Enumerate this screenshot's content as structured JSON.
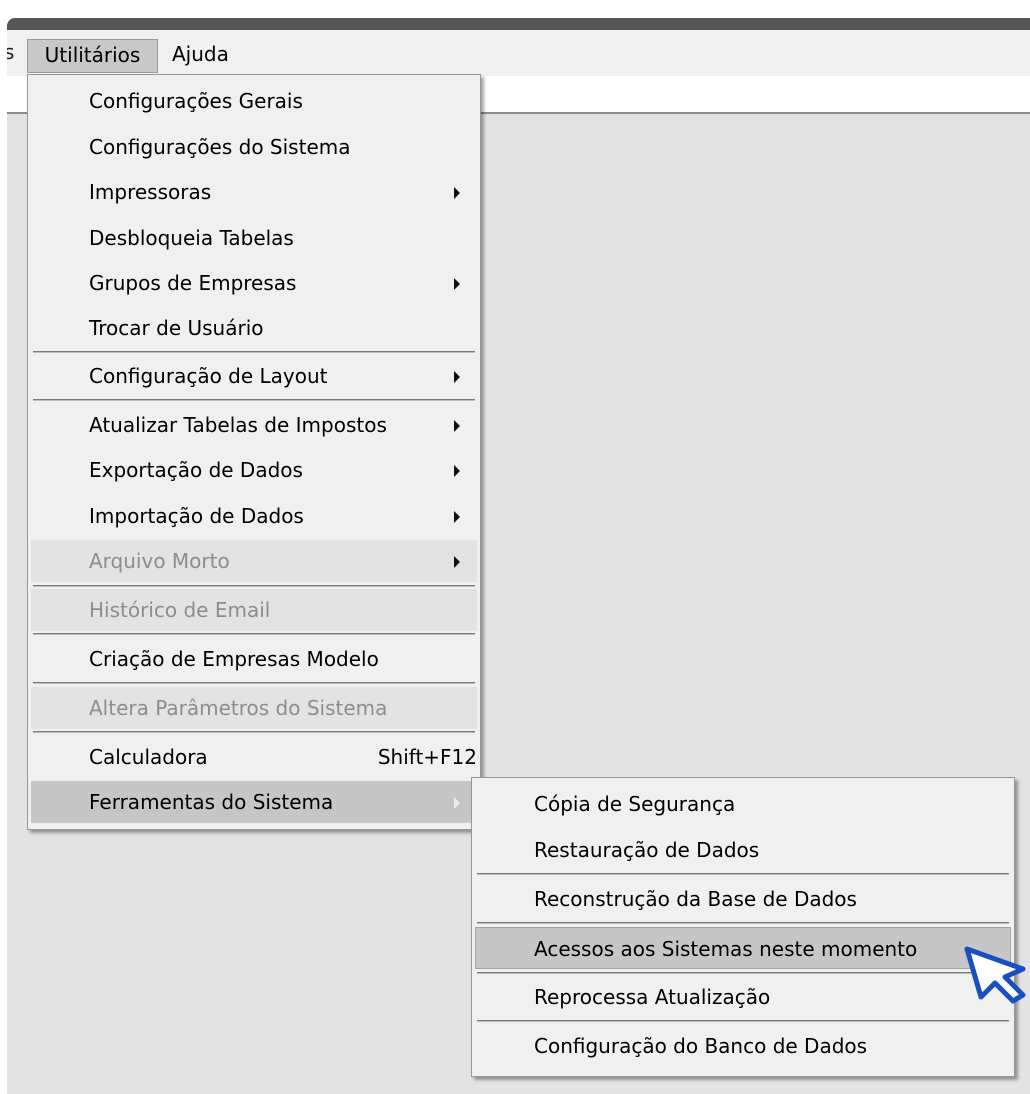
{
  "menubar": {
    "partial_item": "s",
    "items": [
      {
        "label": "Utilitários"
      },
      {
        "label": "Ajuda"
      }
    ]
  },
  "utilitarios_menu": {
    "items": [
      {
        "label": "Configurações Gerais"
      },
      {
        "label": "Configurações do Sistema"
      },
      {
        "label": "Impressoras"
      },
      {
        "label": "Desbloqueia Tabelas"
      },
      {
        "label": "Grupos de Empresas"
      },
      {
        "label": "Trocar de Usuário"
      },
      {
        "label": "Configuração de Layout"
      },
      {
        "label": "Atualizar Tabelas de Impostos"
      },
      {
        "label": "Exportação de Dados"
      },
      {
        "label": "Importação de Dados"
      },
      {
        "label": "Arquivo Morto"
      },
      {
        "label": "Histórico de Email"
      },
      {
        "label": "Criação de Empresas Modelo"
      },
      {
        "label": "Altera Parâmetros do Sistema"
      },
      {
        "label": "Calculadora",
        "shortcut": "Shift+F12"
      },
      {
        "label": "Ferramentas do Sistema"
      }
    ]
  },
  "ferramentas_submenu": {
    "items": [
      {
        "label": "Cópia de Segurança"
      },
      {
        "label": "Restauração de Dados"
      },
      {
        "label": "Reconstrução da Base de Dados"
      },
      {
        "label": "Acessos aos Sistemas neste momento"
      },
      {
        "label": "Reprocessa Atualização"
      },
      {
        "label": "Configuração do Banco de Dados"
      }
    ]
  },
  "colors": {
    "menu_background": "#f0f0f0",
    "workspace": "#e3e3e3",
    "highlight": "#c6c6c6",
    "disabled_text": "#8d8d8d",
    "cursor_outline": "#1a4fbf"
  }
}
